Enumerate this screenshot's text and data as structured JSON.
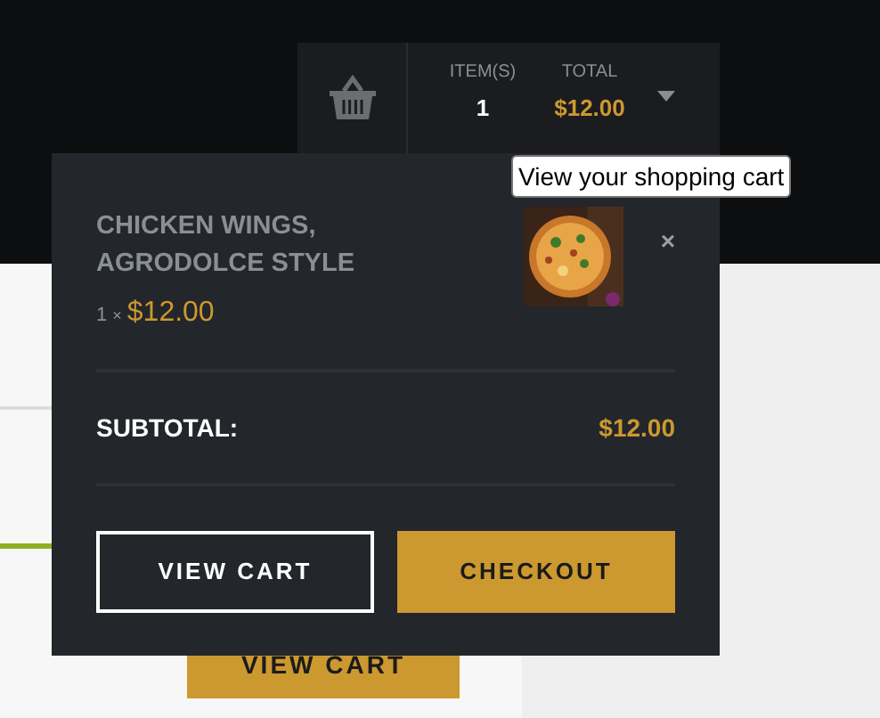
{
  "cart_widget": {
    "items_label": "ITEM(S)",
    "items_count": "1",
    "total_label": "TOTAL",
    "total": "$12.00"
  },
  "tooltip": "View your shopping cart",
  "cart_panel": {
    "items": [
      {
        "name": "CHICKEN WINGS, AGRODOLCE STYLE",
        "quantity": "1",
        "times": "×",
        "price": "$12.00",
        "remove": "×"
      }
    ],
    "subtotal_label": "SUBTOTAL:",
    "subtotal": "$12.00",
    "buttons": [
      {
        "label": "VIEW CART",
        "kind": "outline"
      },
      {
        "label": "CHECKOUT",
        "kind": "filled"
      }
    ]
  },
  "page_button": "VIEW CART"
}
